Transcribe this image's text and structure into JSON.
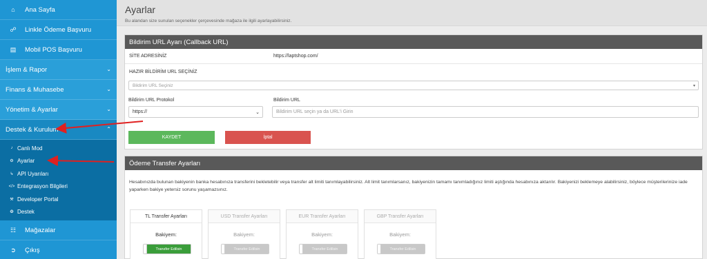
{
  "sidebar": {
    "top_items": [
      {
        "label": "Ana Sayfa",
        "icon": "home-icon"
      },
      {
        "label": "Linkle Ödeme Başvuru",
        "icon": "link-icon"
      },
      {
        "label": "Mobil POS Başvuru",
        "icon": "credit-card-icon"
      }
    ],
    "groups": [
      {
        "label": "İşlem & Rapor"
      },
      {
        "label": "Finans & Muhasebe"
      },
      {
        "label": "Yönetim & Ayarlar"
      },
      {
        "label": "Destek & Kurulum"
      }
    ],
    "sub_items": [
      {
        "label": "Canlı Mod",
        "icon": "music-note-icon"
      },
      {
        "label": "Ayarlar",
        "icon": "gears-icon"
      },
      {
        "label": "API Uyarıları",
        "icon": "level-down-icon"
      },
      {
        "label": "Entegrasyon Bilgileri",
        "icon": "code-icon"
      },
      {
        "label": "Developer Portal",
        "icon": "wrench-icon"
      },
      {
        "label": "Destek",
        "icon": "support-icon"
      }
    ],
    "bottom_items": [
      {
        "label": "Mağazalar",
        "icon": "sitemap-icon"
      },
      {
        "label": "Çıkış",
        "icon": "sign-out-icon"
      }
    ]
  },
  "header": {
    "title": "Ayarlar",
    "subtitle": "Bu alandan size sunulan seçenekler çerçevesinde mağaza ile ilgili ayarlayabilirsiniz."
  },
  "callback_panel": {
    "title": "Bildirim URL Ayarı (Callback URL)",
    "site_label": "SİTE ADRESİNİZ",
    "site_value": "https://laptshop.com/",
    "preset_label": "HAZIR BİLDİRİM URL SEÇİNİZ",
    "preset_placeholder": "Bildirim URL Seçiniz",
    "protocol_label": "Bildirim URL Protokol",
    "protocol_value": "https://",
    "url_label": "Bildirim URL",
    "url_placeholder": "Bildirim URL seçin ya da URL'i Girin",
    "save_label": "KAYDET",
    "cancel_label": "İptal"
  },
  "transfer_panel": {
    "title": "Ödeme Transfer Ayarları",
    "description": "Hesabınızda bulunan bakiyenin banka hesabınıza transferini bekletebilir veya transfer alt limiti tanımlayabilirsiniz. Alt limit tanımlarsanız, bakiyenizin tamamı tanımladığınız limiti aştığında hesabınıza aktarılır. Bakiyenizi beklemeye alabilirsiniz, böylece müşterilerinize iade yaparken bakiye yetersiz sorunu yaşamazsınız.",
    "cards": [
      {
        "title": "TL Transfer Ayarları",
        "balance_label": "Bakiyem:",
        "toggle_label": "Transfer Edilsin",
        "enabled": true
      },
      {
        "title": "USD Transfer Ayarları",
        "balance_label": "Bakiyem:",
        "toggle_label": "Transfer Edilsin",
        "enabled": false
      },
      {
        "title": "EUR Transfer Ayarları",
        "balance_label": "Bakiyem:",
        "toggle_label": "Transfer Edilsin",
        "enabled": false
      },
      {
        "title": "GBP Transfer Ayarları",
        "balance_label": "Bakiyem:",
        "toggle_label": "Transfer Edilsin",
        "enabled": false
      }
    ]
  },
  "colors": {
    "sidebar": "#1f96d4",
    "submenu": "#0b6ea3",
    "panel_header": "#595959",
    "save": "#5cb85c",
    "cancel": "#d9534f",
    "annotation_arrow": "#e02020"
  }
}
